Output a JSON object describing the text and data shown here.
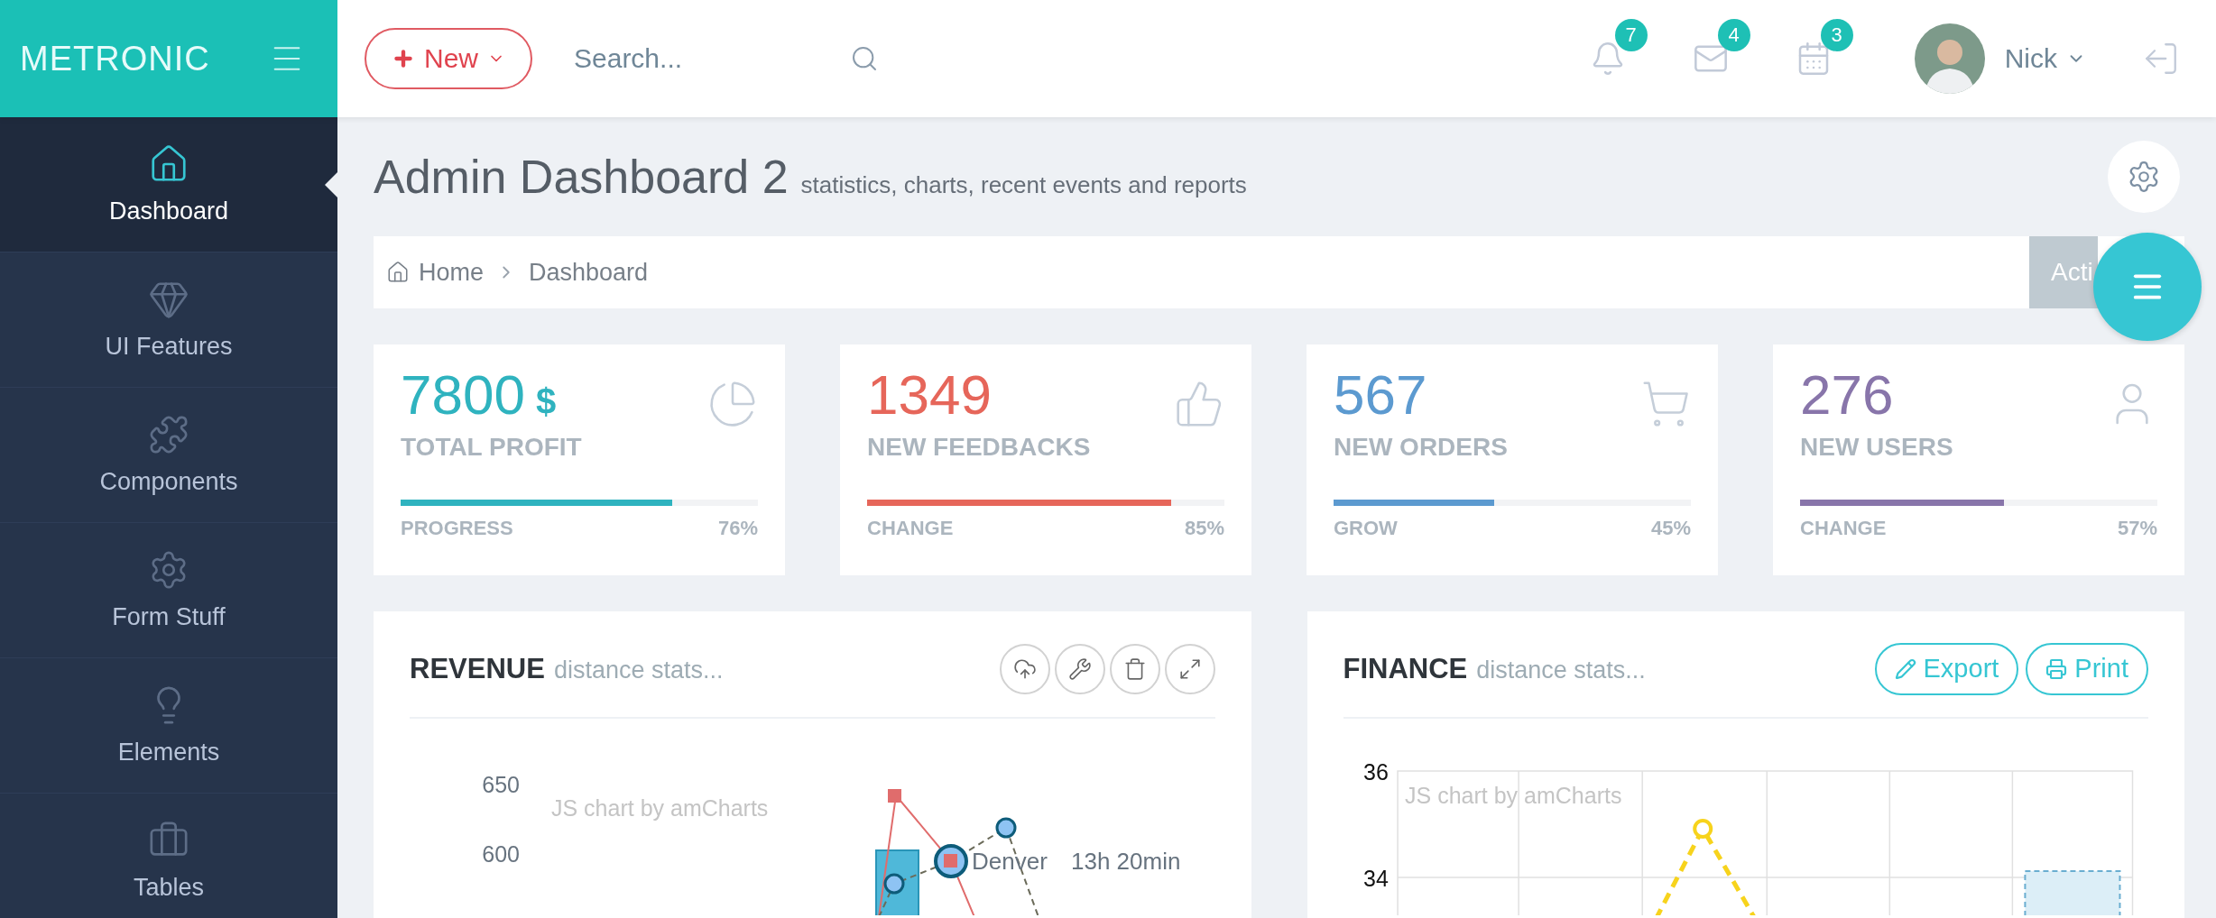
{
  "brand": {
    "logo": "METRONIC"
  },
  "header": {
    "new_button": "New",
    "search": {
      "placeholder": "Search..."
    },
    "notifications": [
      {
        "kind": "bell",
        "count": "7"
      },
      {
        "kind": "mail",
        "count": "4"
      },
      {
        "kind": "calendar",
        "count": "3"
      }
    ],
    "user": {
      "name": "Nick"
    }
  },
  "sidebar": {
    "items": [
      {
        "kind": "home",
        "label": "Dashboard",
        "selected": true
      },
      {
        "kind": "gem",
        "label": "UI Features",
        "selected": false
      },
      {
        "kind": "puzzle",
        "label": "Components",
        "selected": false
      },
      {
        "kind": "gear",
        "label": "Form Stuff",
        "selected": false
      },
      {
        "kind": "bulb",
        "label": "Elements",
        "selected": false
      },
      {
        "kind": "briefcase",
        "label": "Tables",
        "selected": false
      }
    ]
  },
  "page": {
    "title": "Admin Dashboard 2",
    "subtitle": "statistics, charts, recent events and reports"
  },
  "breadcrumb": {
    "items": [
      "Home",
      "Dashboard"
    ],
    "actions_button": "Acti"
  },
  "stats": [
    {
      "kind": "pie",
      "value": "7800",
      "unit": "$",
      "label": "TOTAL PROFIT",
      "color": "#2fb3bf",
      "level": 0.76,
      "footer_label": "PROGRESS",
      "reading": "76%"
    },
    {
      "kind": "thumb",
      "value": "1349",
      "label": "NEW FEEDBACKS",
      "color": "#e6665a",
      "level": 0.85,
      "footer_label": "CHANGE",
      "reading": "85%"
    },
    {
      "kind": "cart",
      "value": "567",
      "label": "NEW ORDERS",
      "color": "#5c9ad0",
      "level": 0.45,
      "footer_label": "GROW",
      "reading": "45%"
    },
    {
      "kind": "user",
      "value": "276",
      "label": "NEW USERS",
      "color": "#8875aa",
      "level": 0.57,
      "footer_label": "CHANGE",
      "reading": "57%"
    }
  ],
  "revenue": {
    "title": "REVENUE",
    "subtitle": "distance stats...",
    "tools": [
      {
        "kind": "upload"
      },
      {
        "kind": "wrench"
      },
      {
        "kind": "trash"
      },
      {
        "kind": "expand"
      }
    ],
    "chart": {
      "credit": "JS chart by amCharts",
      "y_ticks": [
        "650",
        "600"
      ],
      "labels": [
        "Denver",
        "13h 20min"
      ]
    }
  },
  "finance": {
    "title": "FINANCE",
    "subtitle": "distance stats...",
    "buttons": [
      {
        "kind": "export",
        "label": "Export"
      },
      {
        "kind": "print",
        "label": "Print"
      }
    ],
    "chart": {
      "credit": "JS chart by amCharts",
      "y_ticks": [
        "36",
        "34"
      ]
    }
  }
}
